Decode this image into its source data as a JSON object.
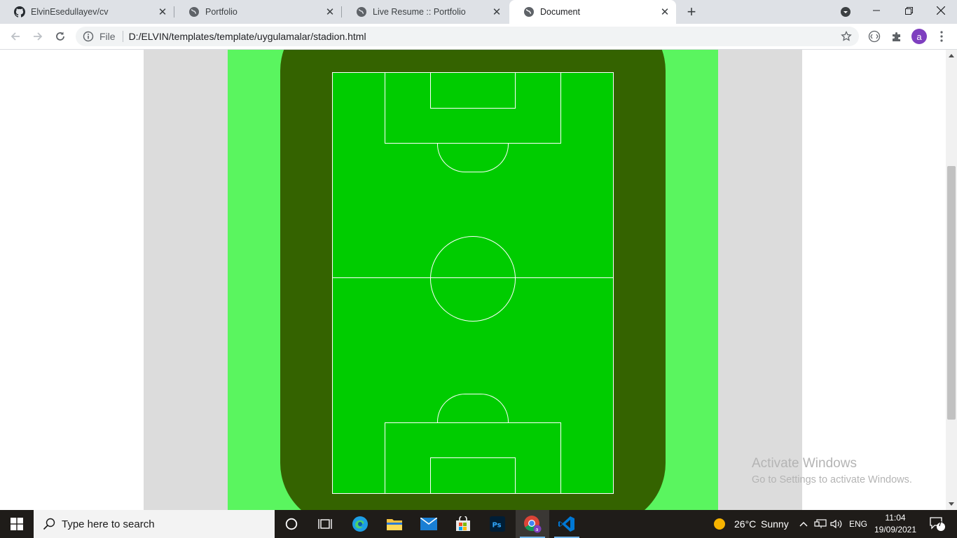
{
  "browser": {
    "tabs": [
      {
        "title": "ElvinEsedullayev/cv",
        "favicon": "github-icon",
        "active": false
      },
      {
        "title": "Portfolio",
        "favicon": "globe-icon",
        "active": false
      },
      {
        "title": "Live Resume :: Portfolio",
        "favicon": "globe-icon",
        "active": false
      },
      {
        "title": "Document",
        "favicon": "globe-icon",
        "active": true
      }
    ],
    "omnibox": {
      "scheme_label": "File",
      "url": "D:/ELVIN/templates/template/uygulamalar/stadion.html"
    },
    "profile_initial": "a",
    "profile_color": "#7e3fbf"
  },
  "page": {
    "colors": {
      "side_band": "#dcdcdc",
      "outer_grass": "#5af55f",
      "track": "#346300",
      "pitch": "#00cc00",
      "pitch_lines": "#ffffff"
    }
  },
  "watermark": {
    "title": "Activate Windows",
    "subtitle": "Go to Settings to activate Windows."
  },
  "taskbar": {
    "search_placeholder": "Type here to search",
    "apps": [
      "cortana-icon",
      "task-view-icon",
      "edge-icon",
      "file-explorer-icon",
      "mail-icon",
      "store-icon",
      "photoshop-icon",
      "chrome-icon",
      "vscode-icon"
    ],
    "weather": {
      "temp": "26°C",
      "condition": "Sunny"
    },
    "language": "ENG",
    "time": "11:04",
    "date": "19/09/2021",
    "notification_count": "7"
  }
}
